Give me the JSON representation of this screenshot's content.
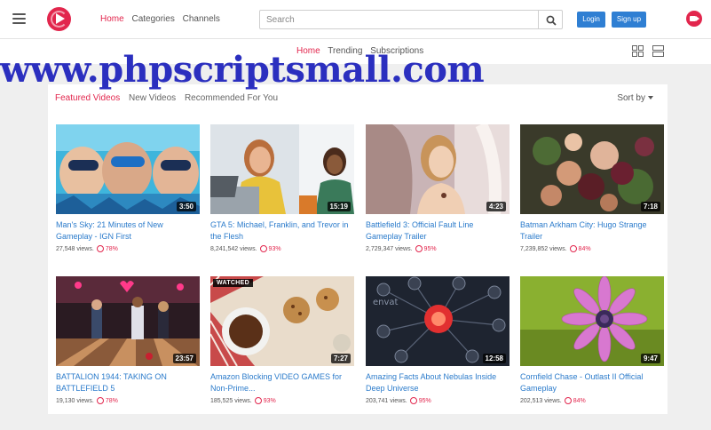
{
  "header": {
    "nav": [
      "Home",
      "Categories",
      "Channels"
    ],
    "search_placeholder": "Search",
    "login_label": "Login",
    "signup_label": "Sign up"
  },
  "subnav": {
    "links": [
      "Home",
      "Trending",
      "Subscriptions"
    ]
  },
  "watermark": "www.phpscriptsmall.com",
  "content": {
    "tabs": [
      "Featured Videos",
      "New Videos",
      "Recommended For You"
    ],
    "sort_label": "Sort by",
    "videos": [
      {
        "title": "Man's Sky: 21 Minutes of New Gameplay - IGN First",
        "duration": "3:50",
        "views": "27,548 views.",
        "rating": "78%"
      },
      {
        "title": "GTA 5: Michael, Franklin, and Trevor in the Flesh",
        "duration": "15:19",
        "views": "8,241,542 views.",
        "rating": "93%"
      },
      {
        "title": "Battlefield 3: Official Fault Line Gameplay Trailer",
        "duration": "4:23",
        "views": "2,729,347 views.",
        "rating": "95%"
      },
      {
        "title": "Batman Arkham City: Hugo Strange Trailer",
        "duration": "7:18",
        "views": "7,239,852 views.",
        "rating": "84%"
      },
      {
        "title": "BATTALION 1944: TAKING ON BATTLEFIELD 5",
        "duration": "23:57",
        "views": "19,130 views.",
        "rating": "78%"
      },
      {
        "title": "Amazon Blocking VIDEO GAMES for Non-Prime...",
        "duration": "7:27",
        "views": "185,525 views.",
        "rating": "93%",
        "badge": "WATCHED"
      },
      {
        "title": "Amazing Facts About Nebulas Inside Deep Universe",
        "duration": "12:58",
        "views": "203,741 views.",
        "rating": "95%",
        "overlay_text": "envat"
      },
      {
        "title": "Cornfield Chase - Outlast II Official Gameplay",
        "duration": "9:47",
        "views": "202,513 views.",
        "rating": "84%"
      }
    ]
  },
  "colors": {
    "accent": "#e2264d",
    "link": "#2b7bcb",
    "button": "#2f7fd3",
    "watermark": "#2b2fbf"
  }
}
